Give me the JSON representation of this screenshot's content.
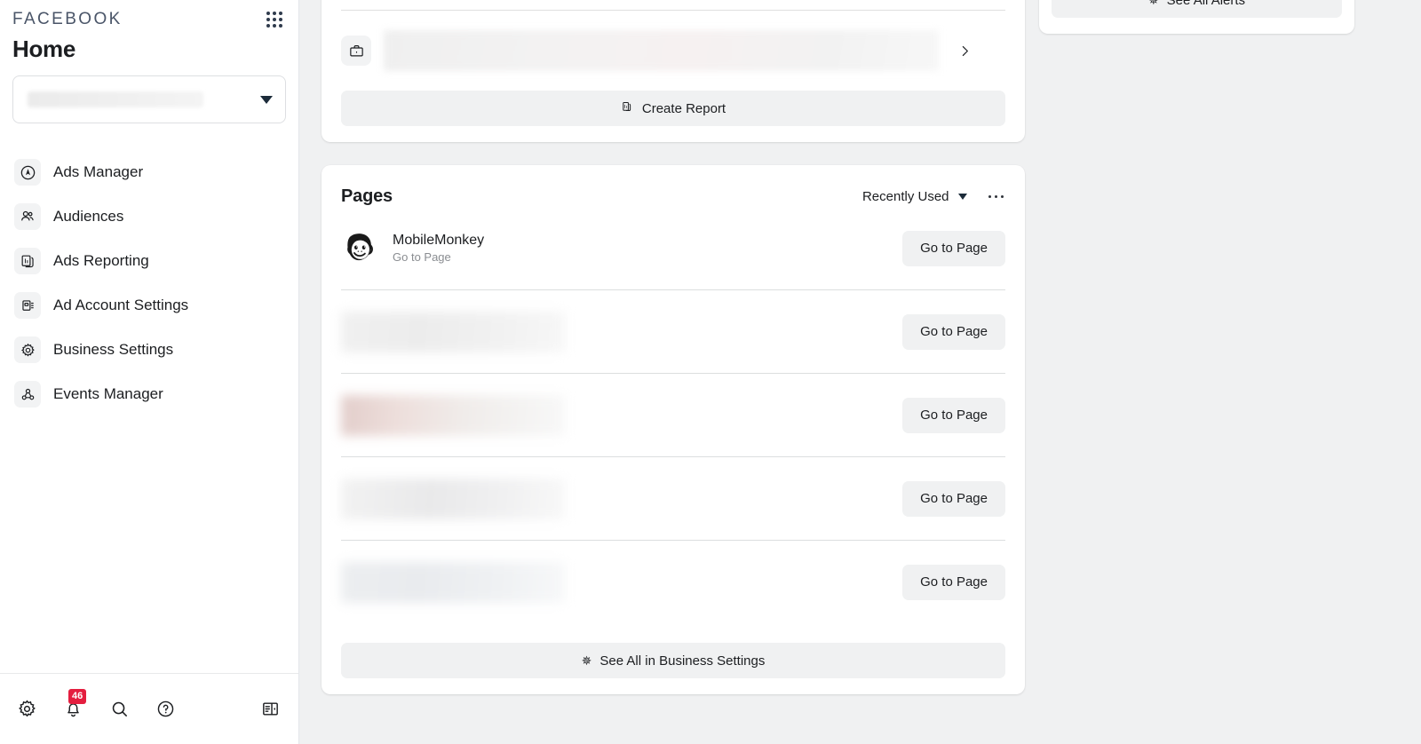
{
  "sidebar": {
    "brand": "FACEBOOK",
    "grid_icon": "app-grid-icon",
    "title": "Home",
    "account_selector": {
      "value": "",
      "redacted": true,
      "caret_icon": "caret-down-icon"
    },
    "nav_items": [
      {
        "label": "Ads Manager",
        "icon": "ads-manager-icon"
      },
      {
        "label": "Audiences",
        "icon": "audiences-icon"
      },
      {
        "label": "Ads Reporting",
        "icon": "ads-reporting-icon"
      },
      {
        "label": "Ad Account Settings",
        "icon": "ad-account-settings-icon"
      },
      {
        "label": "Business Settings",
        "icon": "business-settings-gear-icon"
      },
      {
        "label": "Events Manager",
        "icon": "events-manager-icon"
      }
    ],
    "bottom_bar": {
      "settings_icon": "gear-icon",
      "notifications_icon": "bell-icon",
      "notifications_badge": "46",
      "search_icon": "search-icon",
      "help_icon": "help-question-icon",
      "collapse_icon": "collapse-panel-icon"
    }
  },
  "reports_card": {
    "briefcase_icon": "briefcase-icon",
    "row_value": "",
    "row_redacted": true,
    "chevron_icon": "chevron-right-icon",
    "create_report": {
      "label": "Create Report",
      "icon": "report-icon"
    }
  },
  "pages_card": {
    "title": "Pages",
    "sort": {
      "label": "Recently Used",
      "caret_icon": "caret-down-icon"
    },
    "more_icon": "more-horizontal-icon",
    "action_label": "Go to Page",
    "rows": [
      {
        "name": "MobileMonkey",
        "subtitle": "Go to Page",
        "avatar": "monkey-avatar",
        "redacted": false,
        "action": "Go to Page"
      },
      {
        "name": "",
        "subtitle": "",
        "redacted": true,
        "tint": "a",
        "action": "Go to Page"
      },
      {
        "name": "",
        "subtitle": "",
        "redacted": true,
        "tint": "b",
        "action": "Go to Page"
      },
      {
        "name": "",
        "subtitle": "",
        "redacted": true,
        "tint": "c",
        "action": "Go to Page"
      },
      {
        "name": "",
        "subtitle": "",
        "redacted": true,
        "tint": "d",
        "action": "Go to Page"
      }
    ],
    "footer_button": {
      "label": "See All in Business Settings",
      "icon": "gear-icon"
    }
  },
  "alerts_card": {
    "button": {
      "label": "See All Alerts",
      "icon": "gear-icon"
    }
  },
  "colors": {
    "page_background": "#f0f1f2",
    "card_background": "#ffffff",
    "text_primary": "#1c1e21",
    "text_secondary": "#8a8d91",
    "brand_wordmark": "#4a5568",
    "badge_red": "#e41e3f",
    "button_gray": "#f0f1f2",
    "divider": "#dcdedf"
  }
}
